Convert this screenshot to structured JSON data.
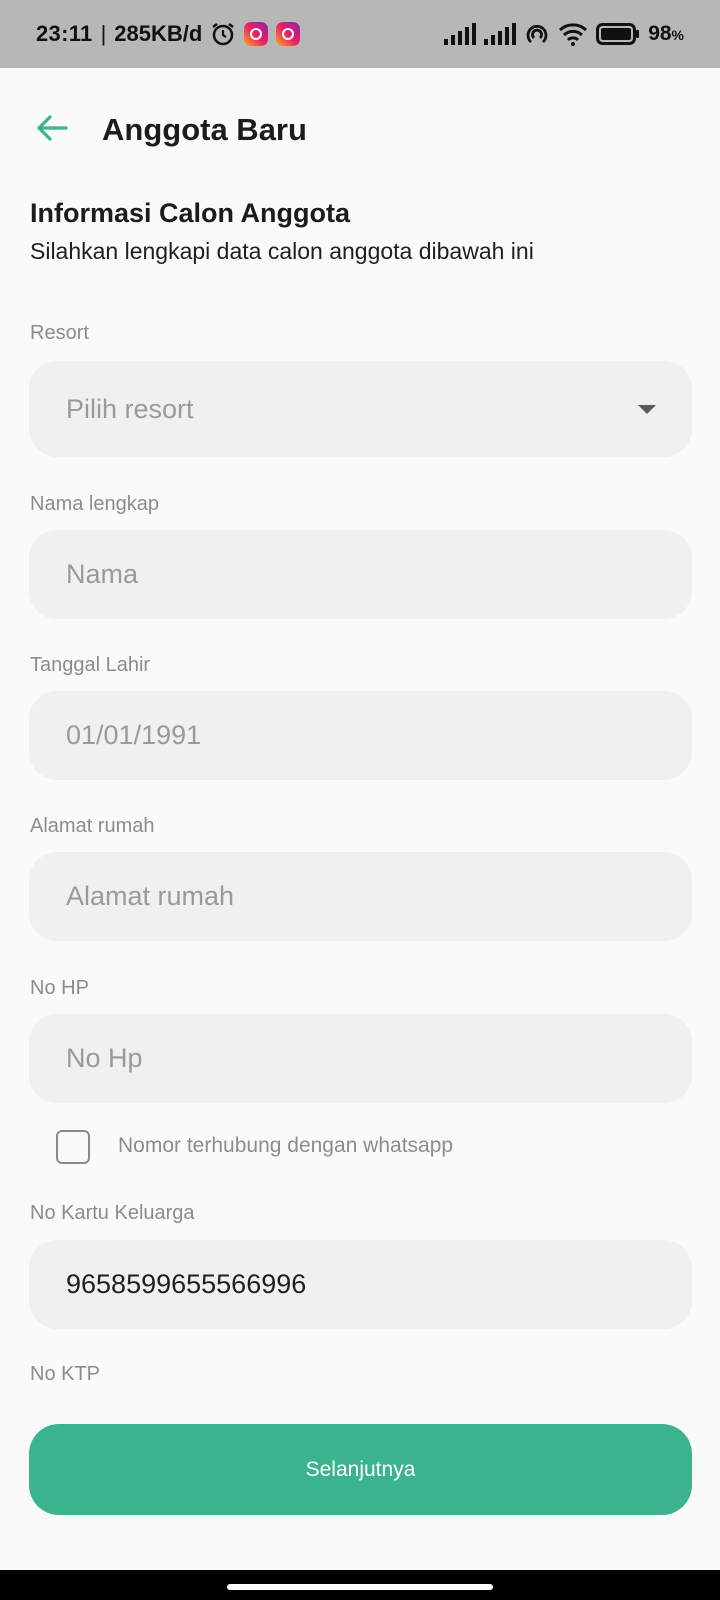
{
  "status_bar": {
    "time": "23:11",
    "separator": "|",
    "network_speed": "285KB/d",
    "battery_percent": "98",
    "battery_unit": "%",
    "icons": [
      "alarm-icon",
      "instagram-icon",
      "instagram-icon",
      "signal-icon",
      "signal-icon",
      "hotspot-icon",
      "wifi-icon",
      "battery-icon"
    ]
  },
  "header": {
    "title": "Anggota Baru",
    "back_icon": "arrow-left-icon",
    "accent_color": "#3bb48e"
  },
  "intro": {
    "title": "Informasi Calon Anggota",
    "subtitle": "Silahkan lengkapi data calon anggota dibawah ini"
  },
  "form": {
    "resort": {
      "label": "Resort",
      "placeholder": "Pilih resort",
      "value": ""
    },
    "nama": {
      "label": "Nama lengkap",
      "placeholder": "Nama",
      "value": ""
    },
    "tanggal_lahir": {
      "label": "Tanggal Lahir",
      "placeholder": "01/01/1991",
      "value": ""
    },
    "alamat": {
      "label": "Alamat rumah",
      "placeholder": "Alamat rumah",
      "value": ""
    },
    "no_hp": {
      "label": "No HP",
      "placeholder": "No Hp",
      "value": ""
    },
    "whatsapp": {
      "label": "Nomor terhubung dengan whatsapp",
      "checked": false
    },
    "no_kk": {
      "label": "No Kartu Keluarga",
      "value": "9658599655566996"
    },
    "no_ktp": {
      "label": "No KTP",
      "value": ""
    }
  },
  "footer": {
    "next_label": "Selanjutnya",
    "button_color": "#3bb48e"
  }
}
